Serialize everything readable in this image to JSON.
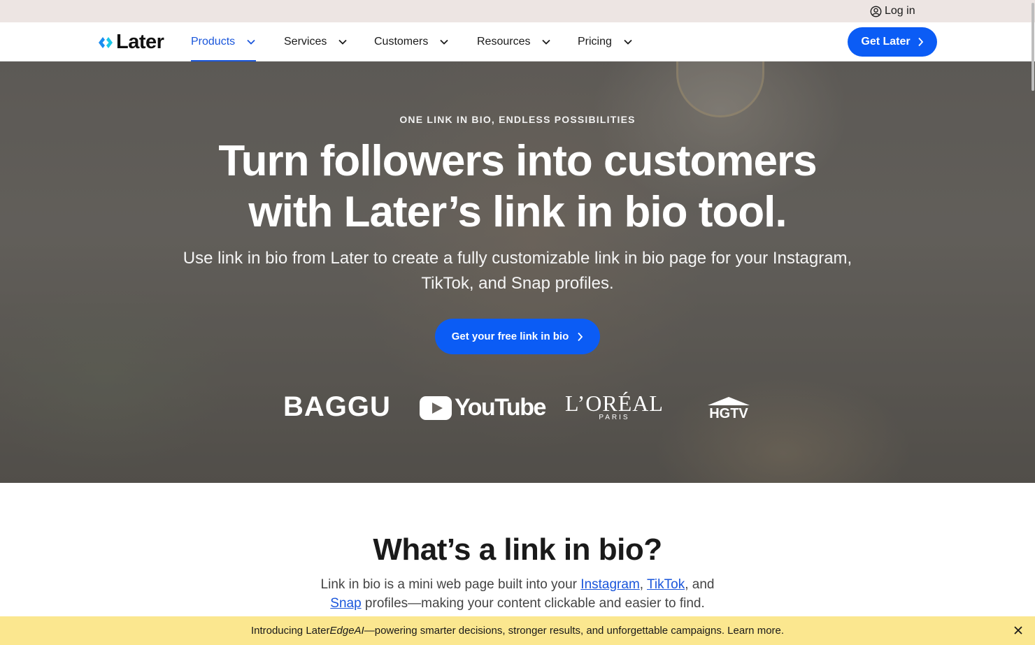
{
  "utility": {
    "login_label": "Log in"
  },
  "nav": {
    "logo_text": "Later",
    "items": [
      {
        "label": "Products"
      },
      {
        "label": "Services"
      },
      {
        "label": "Customers"
      },
      {
        "label": "Resources"
      },
      {
        "label": "Pricing"
      }
    ],
    "cta_label": "Get Later",
    "accent_color": "#0b5cf5"
  },
  "hero": {
    "eyebrow": "ONE LINK IN BIO, ENDLESS POSSIBILITIES",
    "title_line1": "Turn followers into customers",
    "title_line2": "with Later’s link in bio tool.",
    "subtitle": "Use link in bio from Later to create a fully customizable link in bio page for your Instagram, TikTok, and Snap profiles.",
    "cta_label": "Get your free link in bio",
    "brands": {
      "baggu": "BAGGU",
      "youtube": "YouTube",
      "loreal_main": "L’ORÉAL",
      "loreal_sub": "PARIS",
      "hgtv": "HGTV"
    }
  },
  "section": {
    "title": "What’s a link in bio?",
    "body_prefix": "Link in bio is a mini web page built into your ",
    "link_instagram": "Instagram",
    "comma": ", ",
    "link_tiktok": "TikTok",
    "and_text": ", and ",
    "link_snap": "Snap",
    "body_suffix": " profiles—making your content clickable and easier to find."
  },
  "announcement": {
    "prefix": "Introducing Later ",
    "emphasis": "EdgeAI",
    "suffix": "—powering smarter decisions, stronger results, and unforgettable campaigns. Learn more.",
    "background": "#fbe78f"
  }
}
